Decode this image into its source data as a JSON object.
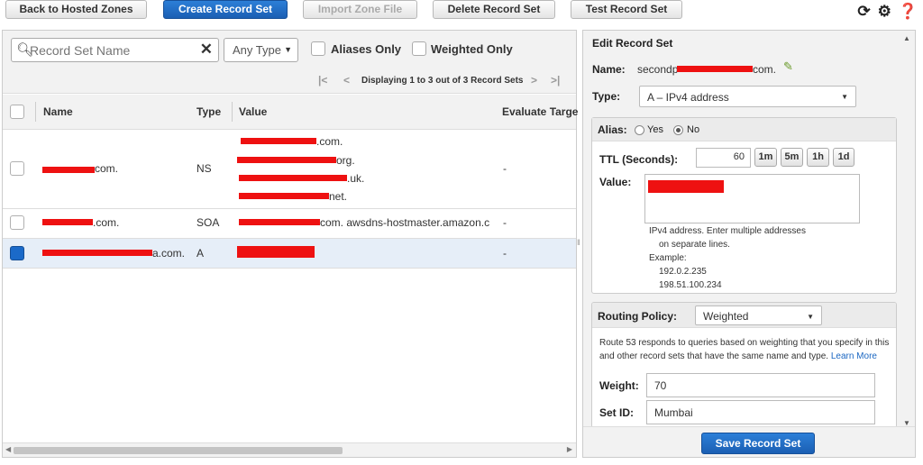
{
  "toolbar": {
    "back": "Back to Hosted Zones",
    "create": "Create Record Set",
    "import": "Import Zone File",
    "delete": "Delete Record Set",
    "test": "Test Record Set"
  },
  "filter": {
    "search_placeholder": "Record Set Name",
    "type_value": "Any Type",
    "aliases_only": "Aliases Only",
    "weighted_only": "Weighted Only",
    "pager_text": "Displaying 1 to 3 out of 3 Record Sets"
  },
  "table": {
    "headers": {
      "name": "Name",
      "type": "Type",
      "value": "Value",
      "evaluate": "Evaluate Targe"
    },
    "rows": [
      {
        "name_suffix": "com.",
        "type": "NS",
        "values": [
          ".com.",
          "org.",
          ".uk.",
          "net."
        ],
        "evaluate": "-"
      },
      {
        "name_suffix": ".com.",
        "type": "SOA",
        "value_text": "com. awsdns-hostmaster.amazon.c",
        "evaluate": "-"
      },
      {
        "name_suffix": "a.com.",
        "type": "A",
        "evaluate": "-"
      }
    ]
  },
  "edit": {
    "title": "Edit Record Set",
    "name_label": "Name:",
    "name_prefix": "secondp",
    "name_suffix": "com.",
    "type_label": "Type:",
    "type_value": "A – IPv4 address",
    "alias_label": "Alias:",
    "alias_yes": "Yes",
    "alias_no": "No",
    "ttl_label": "TTL (Seconds):",
    "ttl_value": "60",
    "ttl_buttons": [
      "1m",
      "5m",
      "1h",
      "1d"
    ],
    "value_label": "Value:",
    "help_lines": [
      "IPv4 address. Enter multiple addresses",
      "on separate lines.",
      "Example:",
      "192.0.2.235",
      "198.51.100.234"
    ],
    "routing_label": "Routing Policy:",
    "routing_value": "Weighted",
    "routing_help_1": "Route 53 responds to queries based on weighting that you specify in this",
    "routing_help_2": "and other record sets that have the same name and type.",
    "learn_more": "Learn More",
    "weight_label": "Weight:",
    "weight_value": "70",
    "setid_label": "Set ID:",
    "setid_value": "Mumbai",
    "save": "Save Record Set"
  },
  "colors": {
    "primary": "#1b6ac9",
    "redaction": "#ee1111"
  }
}
